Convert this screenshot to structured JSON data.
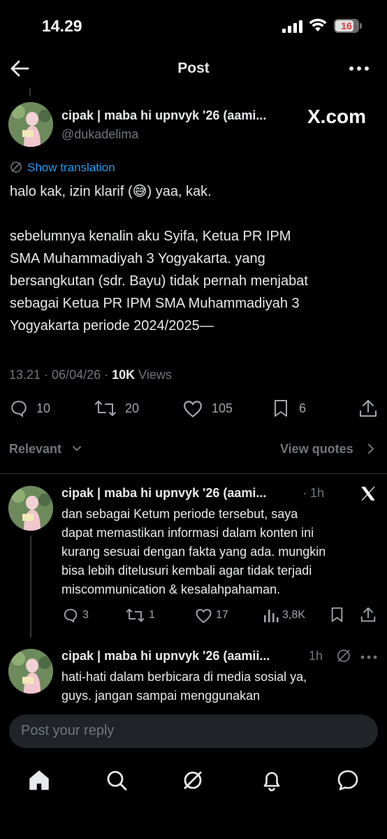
{
  "status_bar": {
    "time": "14.29",
    "battery": "16"
  },
  "header": {
    "title": "Post"
  },
  "post": {
    "author_name": "cipak | maba hi upnvyk '26 (aami...",
    "handle": "@dukadelima",
    "watermark": "X.com",
    "show_translation": "Show translation",
    "line1_pre": "halo kak, izin klarif (",
    "line1_emoji": "😅",
    "line1_post": ") yaa, kak.",
    "paragraph2": [
      "sebelumnya kenalin aku Syifa, Ketua PR IPM",
      "SMA Muhammadiyah 3 Yogyakarta. yang",
      "bersangkutan (sdr. Bayu) tidak pernah menjabat",
      "sebagai Ketua PR IPM SMA Muhammadiyah 3",
      "Yogyakarta periode 2024/2025—"
    ],
    "time_date": "13.21 · 06/04/26 · ",
    "views_count": "10K",
    "views_label": " Views",
    "replies": "10",
    "reposts": "20",
    "likes": "105",
    "bookmarks": "6"
  },
  "sort": {
    "relevant": "Relevant",
    "view_quotes": "View quotes"
  },
  "replies": [
    {
      "name": "cipak | maba hi upnvyk '26 (aami...",
      "time": "· 1h",
      "lines": [
        "dan sebagai Ketum periode tersebut, saya",
        "dapat memastikan informasi dalam konten ini",
        "kurang sesuai dengan fakta yang ada. mungkin",
        "bisa lebih ditelusuri kembali agar tidak terjadi",
        "miscommunication & kesalahpahaman."
      ],
      "replies": "3",
      "reposts": "1",
      "likes": "17",
      "views": "3,8K"
    },
    {
      "name": "cipak | maba hi upnvyk '26 (aamii...",
      "time": "1h",
      "lines": [
        "hati-hati dalam berbicara di media sosial ya,",
        "guys. jangan sampai menggunakan"
      ]
    }
  ],
  "reply_input": {
    "placeholder": "Post your reply"
  },
  "icons": {
    "back": "arrow-left-icon",
    "more": "more-horizontal-icon",
    "translate": "translate-icon",
    "reply": "reply-icon",
    "repost": "repost-icon",
    "like": "heart-icon",
    "bookmark": "bookmark-icon",
    "share": "share-icon",
    "views": "analytics-icon",
    "grok": "grok-icon",
    "home": "home-icon",
    "search": "search-icon",
    "notifications": "bell-icon",
    "messages": "message-icon"
  },
  "colors": {
    "background": "#000000",
    "link": "#1d9bf0",
    "text": "#e7e9ea",
    "muted": "#71767b"
  }
}
